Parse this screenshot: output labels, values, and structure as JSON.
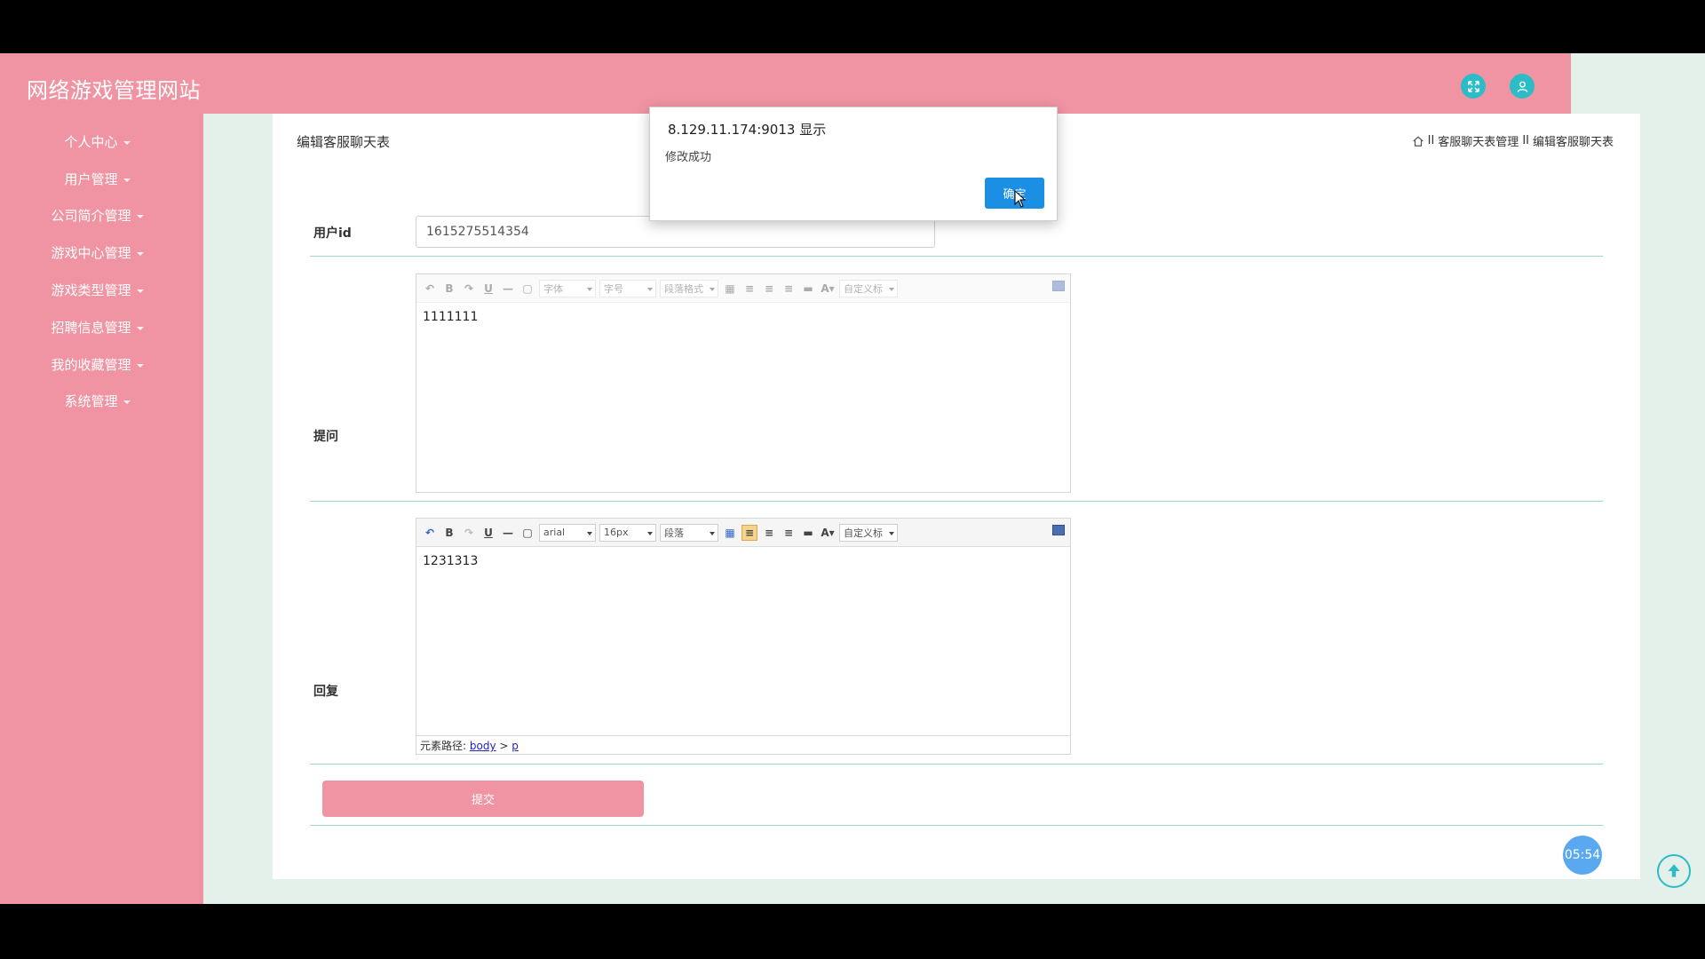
{
  "app": {
    "title": "网络游戏管理网站"
  },
  "header": {
    "icons": [
      "fullscreen-icon",
      "user-icon"
    ]
  },
  "sidebar": {
    "items": [
      {
        "label": "个人中心"
      },
      {
        "label": "用户管理"
      },
      {
        "label": "公司简介管理"
      },
      {
        "label": "游戏中心管理"
      },
      {
        "label": "游戏类型管理"
      },
      {
        "label": "招聘信息管理"
      },
      {
        "label": "我的收藏管理"
      },
      {
        "label": "系统管理"
      }
    ]
  },
  "page": {
    "title": "编辑客服聊天表",
    "breadcrumb": {
      "sep": "II",
      "items": [
        "客服聊天表管理",
        "编辑客服聊天表"
      ]
    }
  },
  "form": {
    "userid_label": "用户id",
    "userid_value": "1615275514354",
    "question_label": "提问",
    "question_content": "1111111",
    "question_toolbar": {
      "font": "字体",
      "size": "字号",
      "format": "段落格式",
      "custom": "自定义标"
    },
    "reply_label": "回复",
    "reply_content": "1231313",
    "reply_toolbar": {
      "font": "arial",
      "size": "16px",
      "format": "段落",
      "custom": "自定义标"
    },
    "path_label": "元素路径:",
    "path_items": [
      "body",
      "p"
    ],
    "path_sep": ">",
    "submit_label": "提交"
  },
  "timer": {
    "value": "05:54"
  },
  "alert": {
    "host": "8.129.11.174:9013 显示",
    "message": "修改成功",
    "ok_label": "确定"
  },
  "colors": {
    "primary": "#f094a3",
    "accent": "#2bbcc7",
    "background": "#e3f1ea",
    "alert_button": "#1a8fe3"
  }
}
